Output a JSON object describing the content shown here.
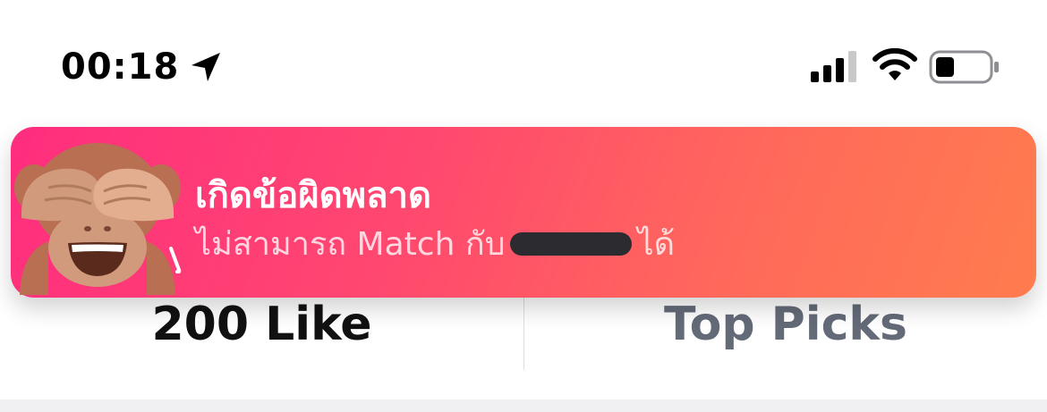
{
  "status_bar": {
    "time": "00:18",
    "icons": [
      "location-arrow-icon",
      "cellular-signal-icon",
      "wifi-icon",
      "battery-low-icon"
    ]
  },
  "banner": {
    "title": "เกิดข้อผิดพลาด",
    "message_prefix": "ไม่สามารถ Match กับ",
    "message_suffix": "ได้",
    "icon": "see-no-evil-monkey-icon",
    "colors": {
      "start": "#ff2d7e",
      "end": "#ff7c4e"
    }
  },
  "tabs": {
    "likes_label": "200 Like",
    "top_picks_label": "Top Picks"
  }
}
